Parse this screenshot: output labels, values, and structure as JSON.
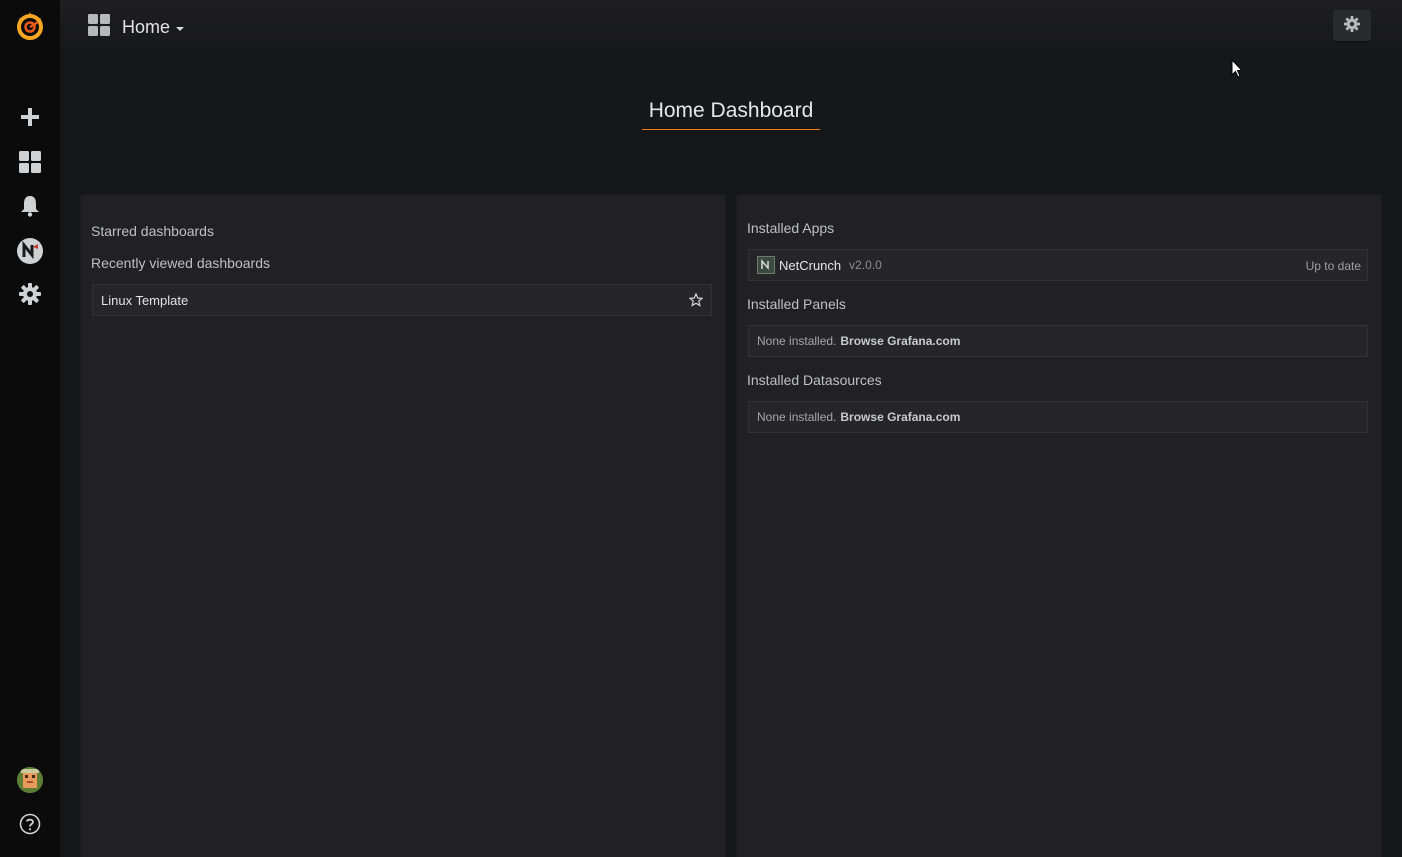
{
  "topbar": {
    "dashboard_picker_label": "Home"
  },
  "page": {
    "title": "Home Dashboard"
  },
  "left_panel": {
    "starred_heading": "Starred dashboards",
    "recent_heading": "Recently viewed dashboards",
    "recent_items": [
      {
        "label": "Linux Template"
      }
    ]
  },
  "right_panel": {
    "apps_heading": "Installed Apps",
    "apps": [
      {
        "name": "NetCrunch",
        "version": "v2.0.0",
        "status": "Up to date"
      }
    ],
    "panels_heading": "Installed Panels",
    "panels_none_text": "None installed.",
    "panels_browse_link": "Browse Grafana.com",
    "datasources_heading": "Installed Datasources",
    "datasources_none_text": "None installed.",
    "datasources_browse_link": "Browse Grafana.com"
  },
  "icons": {
    "sidebar": [
      "grafana-logo-icon",
      "plus-icon",
      "dashboards-icon",
      "bell-icon",
      "netcrunch-icon",
      "gear-icon",
      "avatar",
      "help-icon"
    ]
  },
  "colors": {
    "accent": "#eb7b18",
    "background": "#161719",
    "panel": "#212124",
    "sidebar": "#0b0b0c"
  }
}
